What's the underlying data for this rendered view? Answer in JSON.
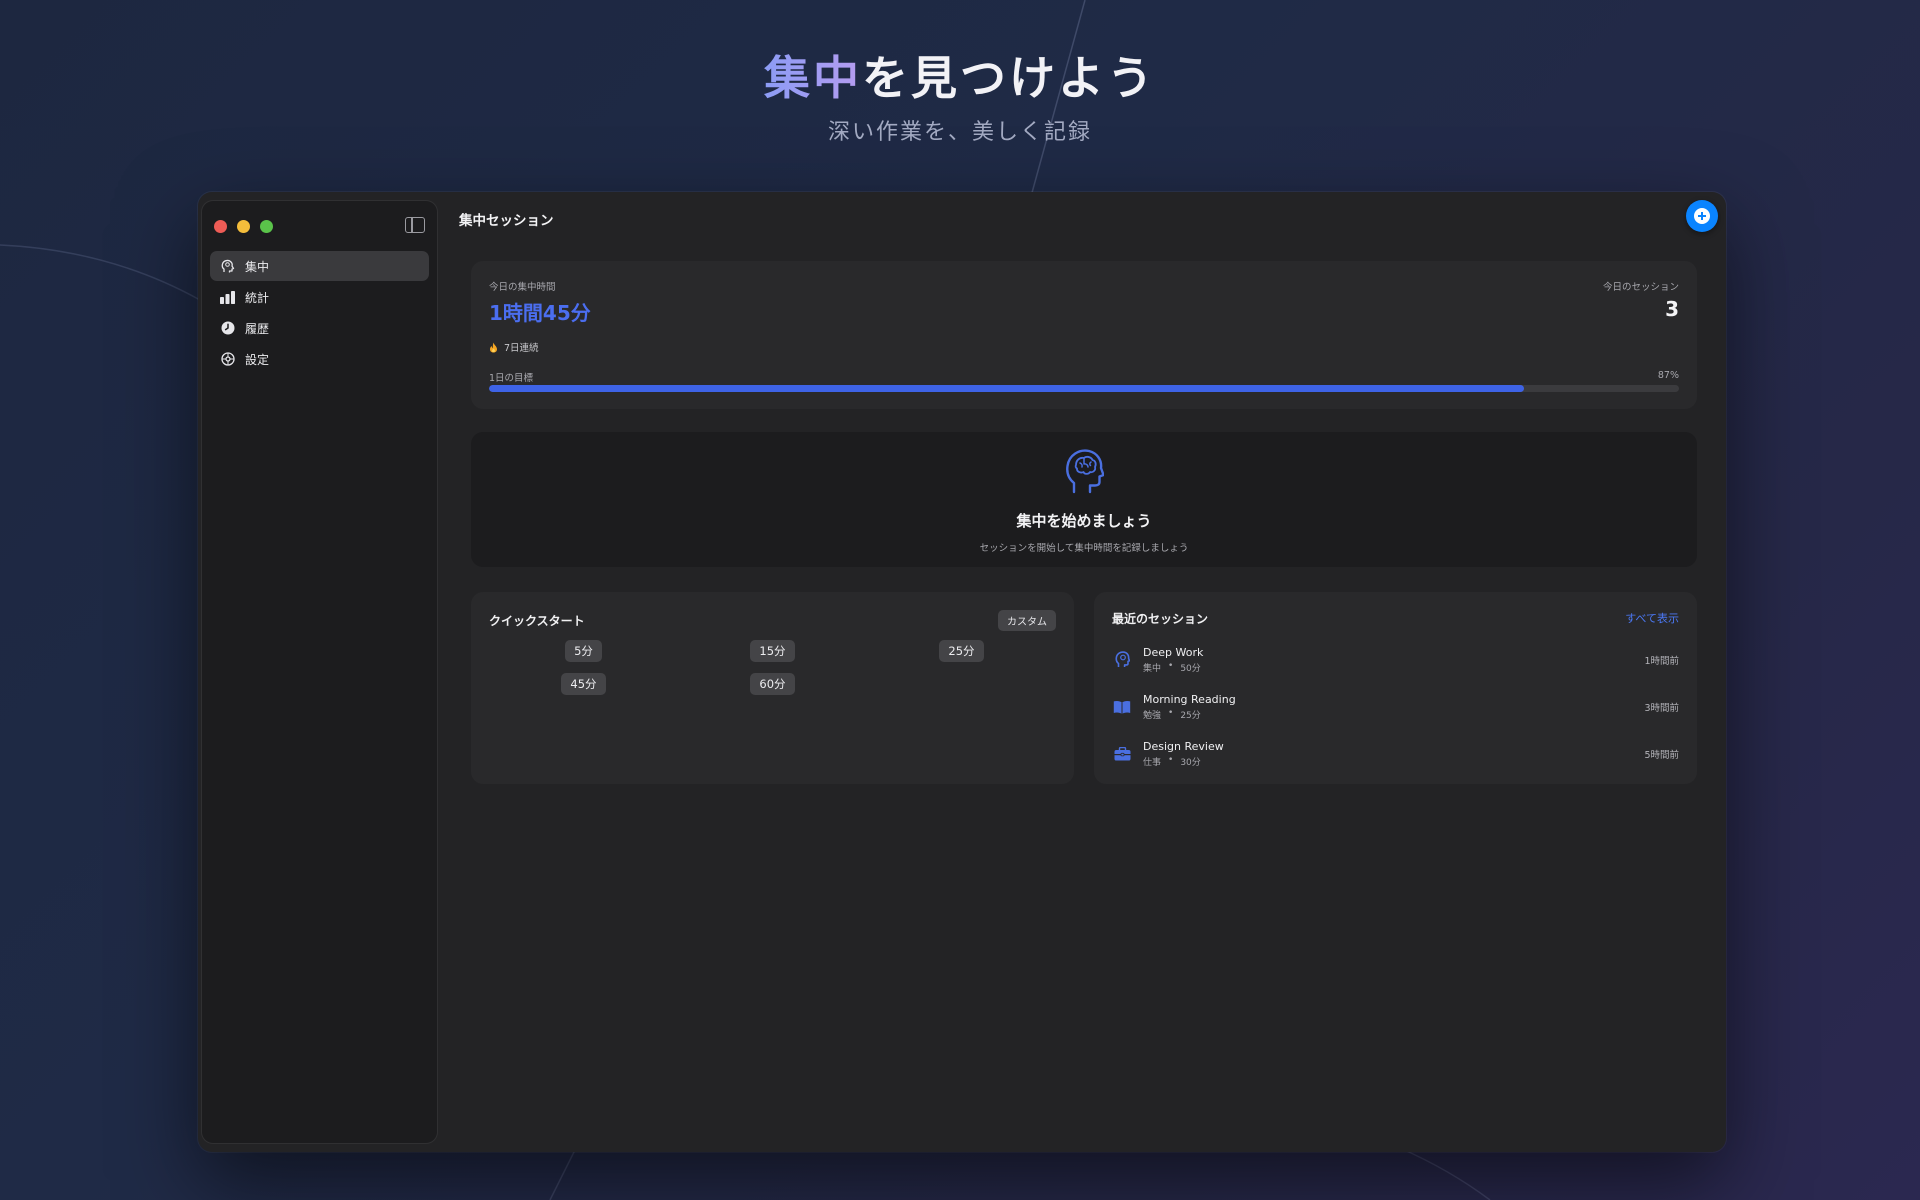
{
  "hero": {
    "title_accent": "集中",
    "title_rest": "を見つけよう",
    "subtitle": "深い作業を、美しく記録"
  },
  "sidebar": {
    "items": [
      {
        "label": "集中",
        "icon": "head-icon",
        "active": true
      },
      {
        "label": "統計",
        "icon": "bar-chart-icon",
        "active": false
      },
      {
        "label": "履歴",
        "icon": "clock-icon",
        "active": false
      },
      {
        "label": "設定",
        "icon": "gear-icon",
        "active": false
      }
    ]
  },
  "main": {
    "title": "集中セッション",
    "add_icon": "plus-circle-icon"
  },
  "stats": {
    "focus_label": "今日の集中時間",
    "focus_value": "1時間45分",
    "sessions_label": "今日のセッション",
    "sessions_value": "3",
    "streak_icon": "flame-icon",
    "streak_text": "7日連続",
    "goal_label": "1日の目標",
    "goal_percent_text": "87%",
    "goal_progress": 0.87,
    "accent_color": "#3e63e6"
  },
  "empty_state": {
    "icon": "brain-head-icon",
    "title": "集中を始めましょう",
    "subtitle": "セッションを開始して集中時間を記録しましょう"
  },
  "quick_start": {
    "title": "クイックスタート",
    "custom_label": "カスタム",
    "options": [
      "5分",
      "15分",
      "25分",
      "45分",
      "60分"
    ]
  },
  "recent_sessions": {
    "title": "最近のセッション",
    "view_all": "すべて表示",
    "items": [
      {
        "name": "Deep Work",
        "category": "集中",
        "separator": "•",
        "duration": "50分",
        "ago": "1時間前",
        "icon": "head-icon"
      },
      {
        "name": "Morning Reading",
        "category": "勉強",
        "separator": "•",
        "duration": "25分",
        "ago": "3時間前",
        "icon": "book-icon"
      },
      {
        "name": "Design Review",
        "category": "仕事",
        "separator": "•",
        "duration": "30分",
        "ago": "5時間前",
        "icon": "briefcase-icon"
      }
    ]
  }
}
